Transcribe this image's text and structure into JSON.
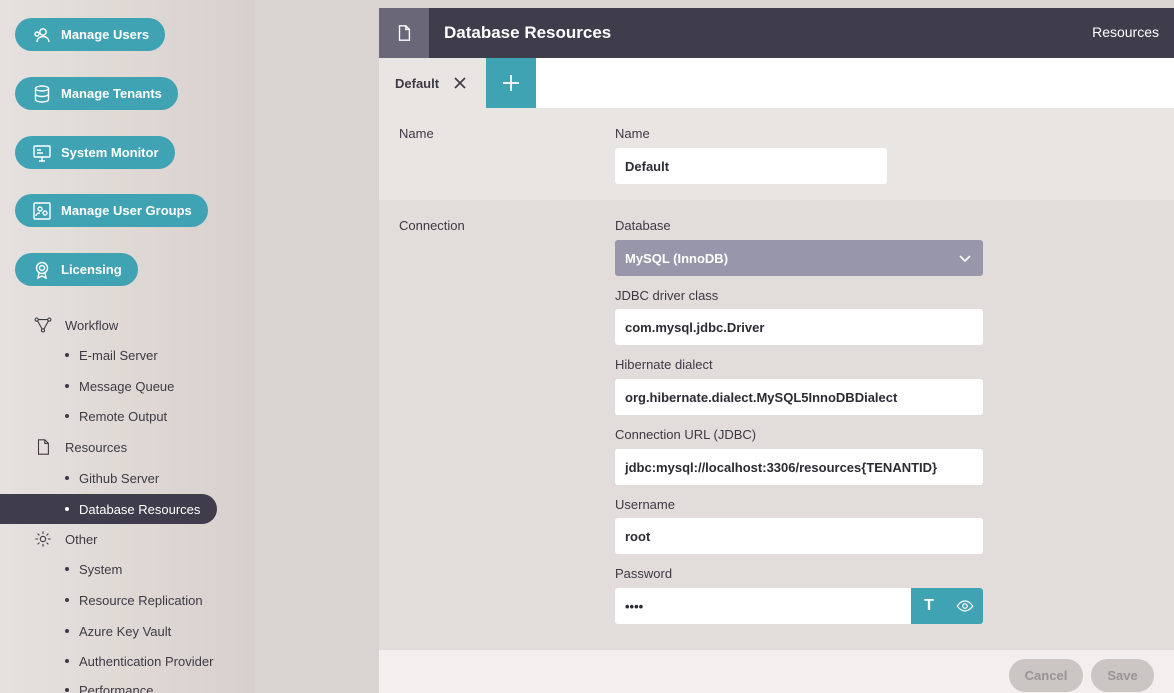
{
  "sidebar": {
    "pills": [
      {
        "label": "Manage Users",
        "icon": "users-icon"
      },
      {
        "label": "Manage Tenants",
        "icon": "database-icon"
      },
      {
        "label": "System Monitor",
        "icon": "monitor-icon"
      },
      {
        "label": "Manage User Groups",
        "icon": "user-groups-icon"
      },
      {
        "label": "Licensing",
        "icon": "license-badge-icon"
      }
    ],
    "workflow": {
      "label": "Workflow",
      "items": [
        "E-mail Server",
        "Message Queue",
        "Remote Output"
      ]
    },
    "resources": {
      "label": "Resources",
      "items": [
        "Github Server",
        "Database Resources"
      ]
    },
    "other": {
      "label": "Other",
      "items": [
        "System",
        "Resource Replication",
        "Azure Key Vault",
        "Authentication Provider",
        "Performance"
      ]
    }
  },
  "header": {
    "title": "Database Resources",
    "crumb": "Resources"
  },
  "tabs": {
    "default_label": "Default"
  },
  "form": {
    "name_section": "Name",
    "name_label": "Name",
    "name_value": "Default",
    "connection_section": "Connection",
    "database_label": "Database",
    "database_value": "MySQL (InnoDB)",
    "jdbc_label": "JDBC driver class",
    "jdbc_value": "com.mysql.jdbc.Driver",
    "dialect_label": "Hibernate dialect",
    "dialect_value": "org.hibernate.dialect.MySQL5InnoDBDialect",
    "url_label": "Connection URL (JDBC)",
    "url_value": "jdbc:mysql://localhost:3306/resources{TENANTID}",
    "username_label": "Username",
    "username_value": "root",
    "password_label": "Password",
    "password_value": "••••"
  },
  "footer": {
    "cancel_label": "Cancel",
    "save_label": "Save"
  },
  "colors": {
    "accent": "#3fa3b3",
    "dark": "#3f3c4b",
    "select": "#9896aa"
  }
}
